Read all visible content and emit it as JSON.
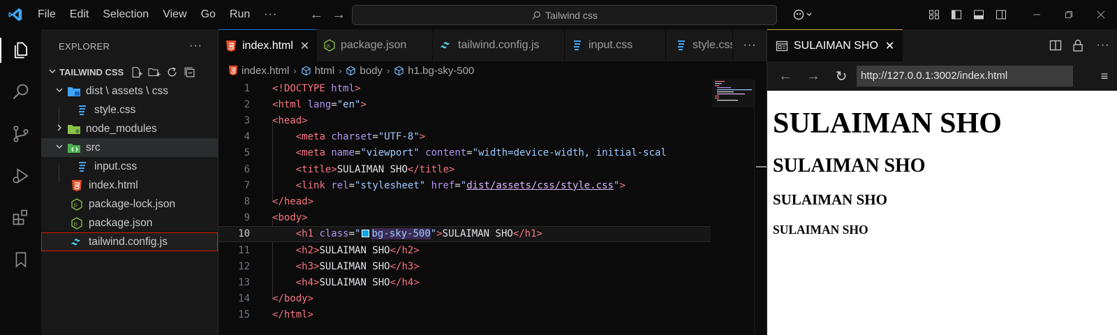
{
  "titlebar": {
    "menus": [
      "File",
      "Edit",
      "Selection",
      "View",
      "Go",
      "Run"
    ],
    "more": "···",
    "search_text": "Tailwind css"
  },
  "activity_bar": {
    "icons": [
      "explorer-icon",
      "search-icon",
      "source-control-icon",
      "run-debug-icon",
      "extensions-icon",
      "bookmarks-icon"
    ]
  },
  "sidebar": {
    "title": "EXPLORER",
    "more": "···",
    "workspace": "TAILWIND CSS",
    "tree": [
      {
        "label": "dist \\ assets \\ css",
        "type": "folder-open",
        "depth": 0
      },
      {
        "label": "style.css",
        "type": "css",
        "depth": 1
      },
      {
        "label": "node_modules",
        "type": "folder-closed",
        "depth": 0
      },
      {
        "label": "src",
        "type": "folder-open",
        "depth": 0
      },
      {
        "label": "input.css",
        "type": "css",
        "depth": 1
      },
      {
        "label": "index.html",
        "type": "html",
        "depth": 0
      },
      {
        "label": "package-lock.json",
        "type": "json",
        "depth": 0
      },
      {
        "label": "package.json",
        "type": "json",
        "depth": 0
      },
      {
        "label": "tailwind.config.js",
        "type": "tailwind",
        "depth": 0
      }
    ]
  },
  "editor": {
    "tabs": [
      {
        "label": "index.html",
        "icon": "html-icon",
        "active": true,
        "close": "✕"
      },
      {
        "label": "package.json",
        "icon": "json-icon",
        "active": false
      },
      {
        "label": "tailwind.config.js",
        "icon": "tailwind-icon",
        "active": false
      },
      {
        "label": "input.css",
        "icon": "css-icon",
        "active": false
      },
      {
        "label": "style.css",
        "icon": "css-icon",
        "active": false
      }
    ],
    "tab_more": "···",
    "breadcrumbs": [
      "index.html",
      "html",
      "body",
      "h1.bg-sky-500"
    ],
    "current_line": 10,
    "line_numbers": [
      "1",
      "2",
      "3",
      "4",
      "5",
      "6",
      "7",
      "8",
      "9",
      "10",
      "11",
      "12",
      "13",
      "14",
      "15"
    ],
    "code": {
      "l1_doctype": "<!DOCTYPE",
      "l1_html": " html",
      "l1_close": ">",
      "html_tag": "html",
      "lang_attr": "lang",
      "lang_val": "\"en\"",
      "head": "head",
      "meta": "meta",
      "charset_attr": "charset",
      "charset_val": "\"UTF-8\"",
      "name_attr": "name",
      "name_val": "\"viewport\"",
      "content_attr": "content",
      "content_val": "\"width=device-width, initial-scal",
      "title": "title",
      "title_text": "SULAIMAN SHO",
      "link": "link",
      "rel_attr": "rel",
      "rel_val": "\"stylesheet\"",
      "href_attr": "href",
      "href_val": "dist/assets/css/style.css",
      "body": "body",
      "h1": "h1",
      "h2": "h2",
      "h3": "h3",
      "h4": "h4",
      "class_attr": "class",
      "class_val": "bg-sky-500",
      "heading_text": "SULAIMAN SHO"
    }
  },
  "browser": {
    "tab_label": "SULAIMAN SHO",
    "tab_close": "✕",
    "url": "http://127.0.0.1:3002/index.html",
    "headings": {
      "h1": "SULAIMAN SHO",
      "h2": "SULAIMAN SHO",
      "h3": "SULAIMAN SHO",
      "h4": "SULAIMAN SHO"
    }
  },
  "colors": {
    "accent": "#0078d4",
    "tag": "#f97583",
    "attr": "#b392f0",
    "string": "#9ecbff",
    "swatch_sky_500": "#0ea5e9",
    "focus_outline": "#e51400"
  }
}
